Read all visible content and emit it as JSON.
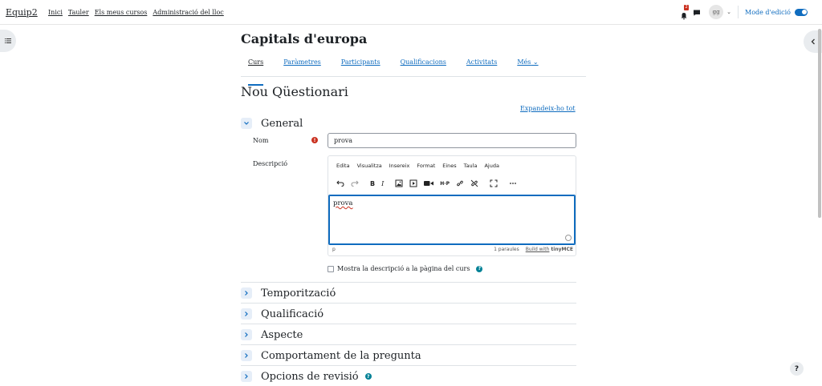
{
  "navbar": {
    "brand": "Equip2",
    "links": [
      "Inici",
      "Tauler",
      "Els meus cursos",
      "Administració del lloc"
    ],
    "notification_count": "2",
    "user_initials": "gg",
    "edit_mode_label": "Mode d'edició",
    "edit_mode_on": true
  },
  "course": {
    "title": "Capitals d'europa",
    "tabs": [
      "Curs",
      "Paràmetres",
      "Participants",
      "Qualificacions",
      "Activitats",
      "Més"
    ],
    "active_tab": "Curs"
  },
  "page": {
    "heading": "Nou Qüestionari",
    "expand_all": "Expandeix-ho tot"
  },
  "general": {
    "title": "General",
    "name_label": "Nom",
    "name_value": "prova",
    "description_label": "Descripció",
    "editor": {
      "menu": [
        "Edita",
        "Visualitza",
        "Insereix",
        "Format",
        "Eines",
        "Taula",
        "Ajuda"
      ],
      "content": "prova",
      "path": "p",
      "word_count": "1 paraules",
      "build_with": "Build with",
      "tinymce": "tinyMCE"
    },
    "show_description_label": "Mostra la descripció a la pàgina del curs"
  },
  "sections": [
    {
      "title": "Temporització"
    },
    {
      "title": "Qualificació"
    },
    {
      "title": "Aspecte"
    },
    {
      "title": "Comportament de la pregunta"
    },
    {
      "title": "Opcions de revisió"
    }
  ],
  "help_button": "?"
}
